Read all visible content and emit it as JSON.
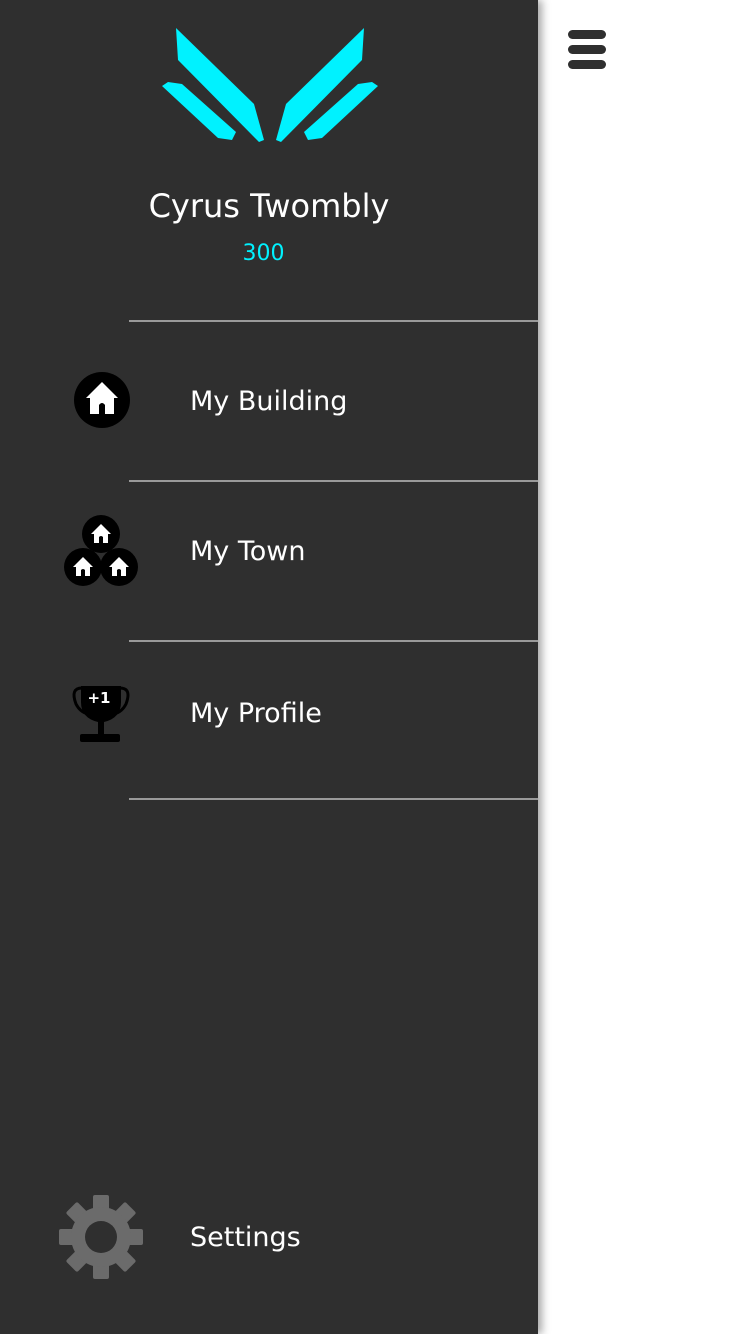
{
  "colors": {
    "drawer_background": "#2f2f2f",
    "accent": "#00f2ff",
    "divider": "#9a9a9a",
    "content_background": "#ffffff"
  },
  "header": {
    "logo_icon": "wings-logo",
    "user_name": "Cyrus Twombly",
    "points": "300"
  },
  "menu": {
    "items": [
      {
        "id": "building",
        "label": "My Building",
        "icon": "house-circle-icon"
      },
      {
        "id": "town",
        "label": "My Town",
        "icon": "houses-cluster-icon"
      },
      {
        "id": "profile",
        "label": "My Profile",
        "icon": "trophy-plus-one-icon",
        "icon_text": "+1"
      }
    ],
    "settings": {
      "label": "Settings",
      "icon": "gear-icon"
    }
  },
  "toolbar": {
    "menu_icon": "hamburger-menu-icon"
  }
}
